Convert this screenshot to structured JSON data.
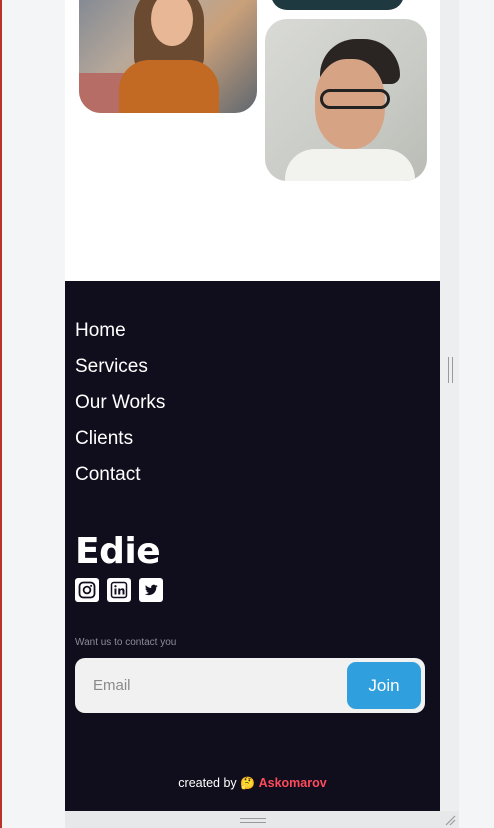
{
  "nav": {
    "items": [
      "Home",
      "Services",
      "Our Works",
      "Clients",
      "Contact"
    ]
  },
  "brand": {
    "name": "Edie"
  },
  "socials": [
    {
      "icon": "instagram-icon"
    },
    {
      "icon": "linkedin-icon"
    },
    {
      "icon": "twitter-icon"
    }
  ],
  "contact": {
    "label": "Want us to contact you",
    "email_placeholder": "Email",
    "join_label": "Join"
  },
  "credit": {
    "prefix": "created by",
    "emoji": "🤔",
    "author": "Askomarov"
  },
  "colors": {
    "footer_bg": "#100e1c",
    "join_button": "#2f9fdd",
    "author_accent": "#ff4a5c"
  }
}
